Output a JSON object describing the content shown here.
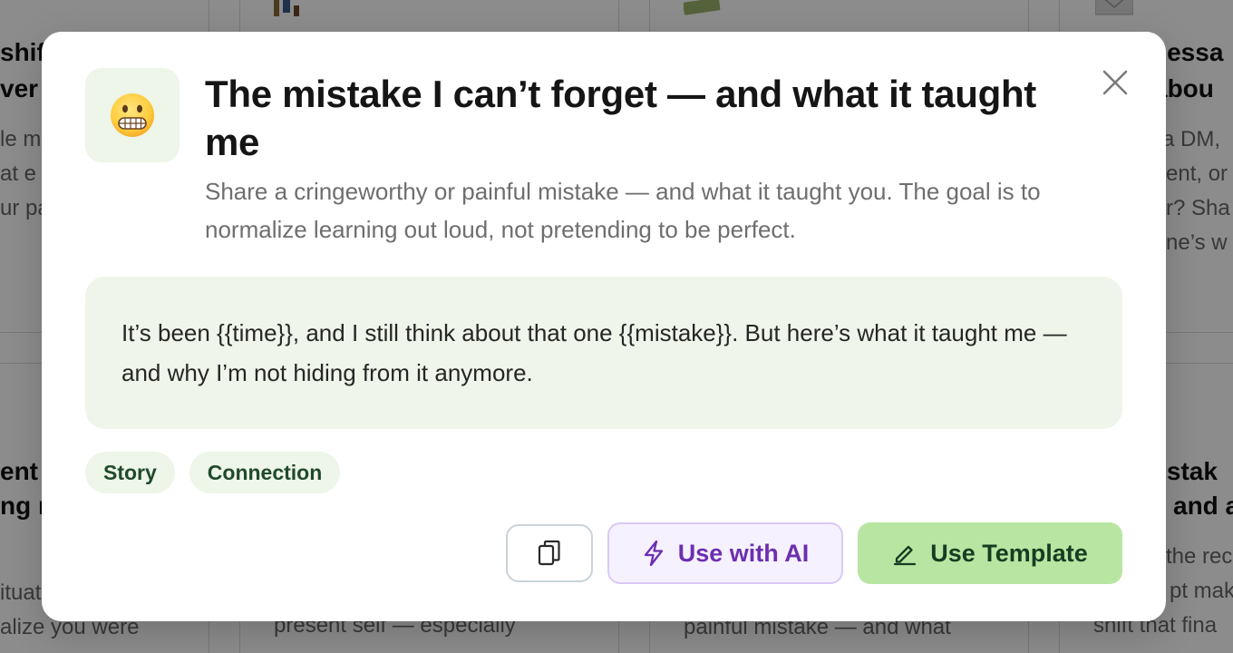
{
  "background": {
    "cards": [
      {
        "title_lines": [
          "shif",
          "ver"
        ],
        "body_lines": [
          "le m",
          "at e",
          "ur pa"
        ]
      },
      {
        "title_lines": [
          "nessa",
          "abou"
        ],
        "body_lines": [
          "a DM,",
          "ent, or",
          "r? Sha",
          "ne’s w"
        ]
      },
      {
        "title_lines": [
          "ent I",
          "ng m"
        ],
        "body_lines": [
          "ituat",
          "alize you were"
        ]
      },
      {
        "title_lines": [],
        "body_lines": [
          "present self — especially"
        ]
      },
      {
        "title_lines": [],
        "body_lines": [
          "painful mistake — and what"
        ]
      },
      {
        "title_lines": [
          "nistak",
          "and a"
        ],
        "body_lines": [
          "the rec",
          "pt mak",
          "shift that fina"
        ]
      }
    ]
  },
  "modal": {
    "emoji": "😬",
    "title": "The mistake I can’t forget — and what it taught me",
    "description": "Share a cringeworthy or painful mistake — and what it taught you. The goal is to normalize learning out loud, not pretending to be perfect.",
    "template_text": "It’s been {{time}}, and I still think about that one {{mistake}}. But here’s what it taught me — and why I’m not hiding from it anymore.",
    "tags": [
      "Story",
      "Connection"
    ],
    "buttons": {
      "copy_icon": "copy-icon",
      "ai_label": "Use with AI",
      "ai_icon": "lightning-icon",
      "use_label": "Use Template",
      "use_icon": "pencil-icon"
    },
    "close_icon": "close-icon",
    "colors": {
      "accent_green": "#b8e6a2",
      "accent_purple": "#6b2fb0",
      "soft_green": "#eef5e9"
    }
  }
}
